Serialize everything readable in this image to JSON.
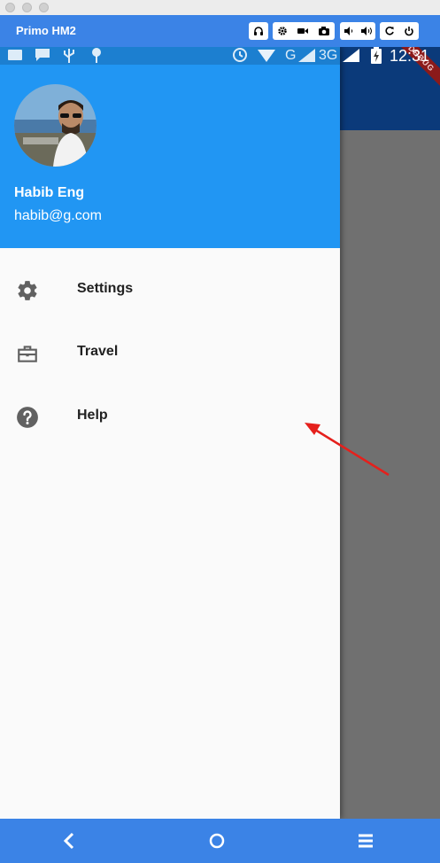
{
  "window": {
    "title": "Primo HM2"
  },
  "status_bar": {
    "time": "12:31",
    "network": "G",
    "network_type": "3G"
  },
  "debug_banner": "DEBUG",
  "drawer": {
    "user": {
      "name": "Habib Eng",
      "email": "habib@g.com"
    },
    "items": [
      {
        "label": "Settings",
        "icon": "gear-icon"
      },
      {
        "label": "Travel",
        "icon": "briefcase-icon"
      },
      {
        "label": "Help",
        "icon": "help-icon"
      }
    ]
  },
  "colors": {
    "header": "#2196f3",
    "emulator_bar": "#3b83e6",
    "app_bar": "#0b3a7a",
    "arrow": "#e5201c"
  }
}
